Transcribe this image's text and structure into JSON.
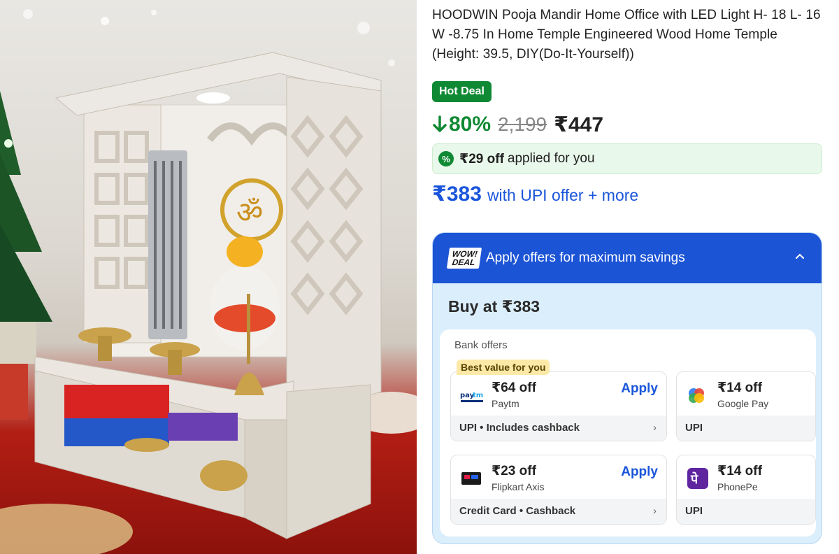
{
  "product": {
    "title": "HOODWIN Pooja Mandir Home Office with LED Light H- 18 L- 16 W -8.75 In Home Temple Engineered Wood Home Temple (Height: 39.5, DIY(Do-It-Yourself))",
    "badge": "Hot Deal",
    "discount": "80%",
    "mrp": "2,199",
    "price": "₹447",
    "applied_offer_amount": "₹29 off",
    "applied_offer_text": "applied for you",
    "upi_price": "₹383",
    "upi_text": "with UPI offer + more"
  },
  "deal": {
    "logo_line1": "WOW!",
    "logo_line2": "DEAL",
    "header": "Apply offers for maximum savings",
    "buy_at": "Buy at ₹383",
    "bank_offers_title": "Bank offers",
    "best_value_badge": "Best value for you",
    "offers": [
      {
        "amount": "₹64 off",
        "provider": "Paytm",
        "apply": "Apply",
        "footer": "UPI • Includes cashback",
        "logo": "paytm-icon"
      },
      {
        "amount": "₹14 off",
        "provider": "Google Pay",
        "footer": "UPI",
        "logo": "google-pay-icon"
      },
      {
        "amount": "₹23 off",
        "provider": "Flipkart Axis",
        "apply": "Apply",
        "footer": "Credit Card • Cashback",
        "logo": "flipkart-axis-card-icon"
      },
      {
        "amount": "₹14 off",
        "provider": "PhonePe",
        "footer": "UPI",
        "logo": "phonepe-icon"
      }
    ]
  },
  "icons": {
    "discount_arrow": "arrow-down-icon",
    "percent": "percent-badge-icon",
    "collapse": "chevron-up-icon",
    "next": "chevron-right-icon"
  },
  "colors": {
    "green": "#108934",
    "blue": "#1a56db",
    "deal_header": "#1c54d6",
    "deal_bg": "#dbeefb",
    "best_badge": "#fde9a7"
  }
}
